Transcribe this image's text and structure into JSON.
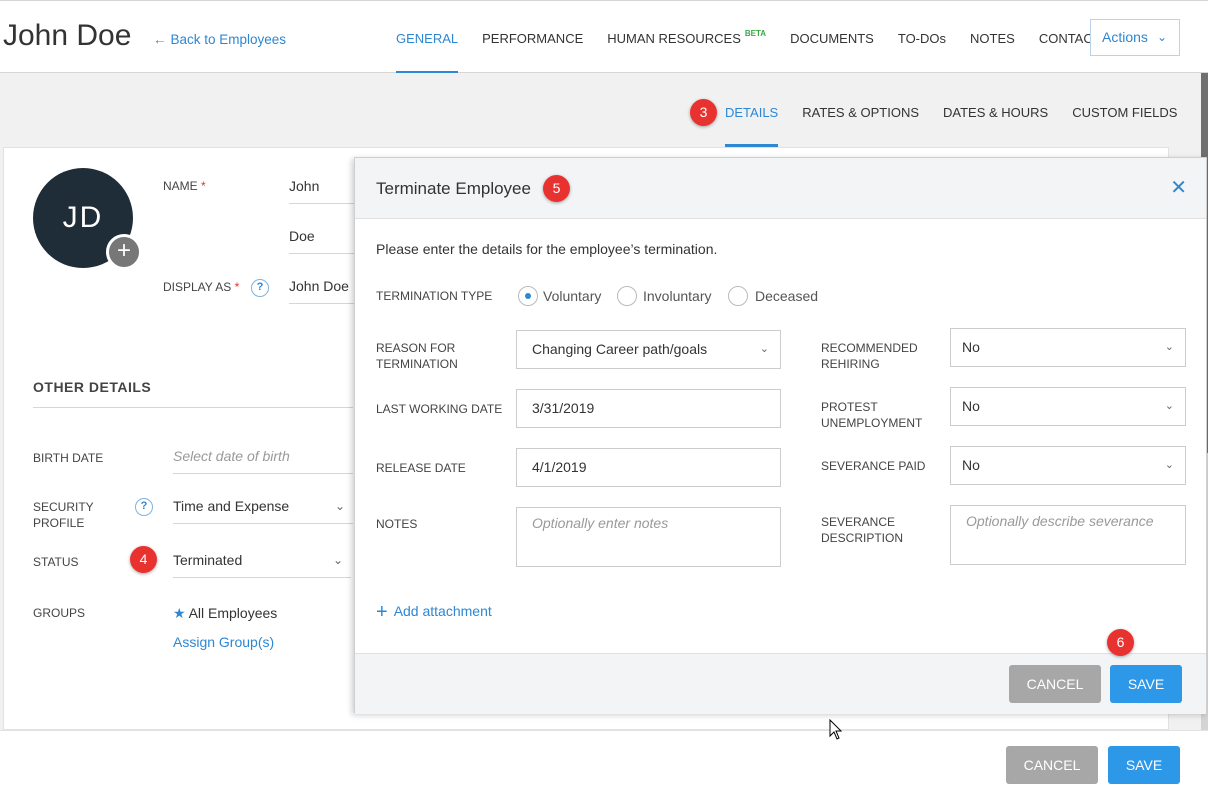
{
  "header": {
    "employee_name": "John Doe",
    "back_link": "Back to Employees",
    "tabs": [
      {
        "label": "GENERAL",
        "active": true
      },
      {
        "label": "PERFORMANCE",
        "active": false
      },
      {
        "label": "HUMAN RESOURCES",
        "beta": "BETA",
        "active": false
      },
      {
        "label": "DOCUMENTS",
        "active": false
      },
      {
        "label": "TO-DOs",
        "active": false
      },
      {
        "label": "NOTES",
        "active": false
      },
      {
        "label": "CONTACT",
        "active": false
      }
    ],
    "actions_label": "Actions"
  },
  "subtabs": [
    {
      "label": "DETAILS",
      "active": true
    },
    {
      "label": "RATES & OPTIONS",
      "active": false
    },
    {
      "label": "DATES & HOURS",
      "active": false
    },
    {
      "label": "CUSTOM FIELDS",
      "active": false
    }
  ],
  "badges": [
    "3",
    "4",
    "5",
    "6"
  ],
  "profile": {
    "initials": "JD",
    "name_label": "NAME",
    "required_mark": "*",
    "first_name": "John",
    "last_name": "Doe",
    "display_as_label": "DISPLAY AS",
    "display_as": "John Doe",
    "help_glyph": "?"
  },
  "other_details": {
    "title": "OTHER DETAILS",
    "birth_date_label": "BIRTH DATE",
    "birth_date_placeholder": "Select date of birth",
    "security_profile_label": "SECURITY PROFILE",
    "security_profile": "Time and Expense",
    "status_label": "STATUS",
    "status": "Terminated",
    "groups_label": "GROUPS",
    "group": "All Employees",
    "assign_groups": "Assign Group(s)"
  },
  "modal": {
    "title": "Terminate Employee",
    "intro": "Please enter the details for the employee’s termination.",
    "termination_type_label": "TERMINATION TYPE",
    "termination_types": [
      {
        "label": "Voluntary",
        "selected": true
      },
      {
        "label": "Involuntary",
        "selected": false
      },
      {
        "label": "Deceased",
        "selected": false
      }
    ],
    "reason_label": "REASON FOR TERMINATION",
    "reason": "Changing Career path/goals",
    "last_working_date_label": "LAST WORKING DATE",
    "last_working_date": "3/31/2019",
    "release_date_label": "RELEASE DATE",
    "release_date": "4/1/2019",
    "notes_label": "NOTES",
    "notes_placeholder": "Optionally enter notes",
    "recommended_rehiring_label": "RECOMMENDED REHIRING",
    "recommended_rehiring": "No",
    "protest_unemployment_label": "PROTEST UNEMPLOYMENT",
    "protest_unemployment": "No",
    "severance_paid_label": "SEVERANCE PAID",
    "severance_paid": "No",
    "severance_description_label": "SEVERANCE DESCRIPTION",
    "severance_description_placeholder": "Optionally describe severance",
    "add_attachment": "Add attachment",
    "cancel": "CANCEL",
    "save": "SAVE"
  },
  "footer": {
    "cancel": "CANCEL",
    "save": "SAVE"
  },
  "colors": {
    "accent": "#2d87d3",
    "badge": "#e8322f",
    "save_button": "#2d97e8",
    "cancel_button": "#a7a7a7",
    "avatar": "#1f2d38"
  }
}
